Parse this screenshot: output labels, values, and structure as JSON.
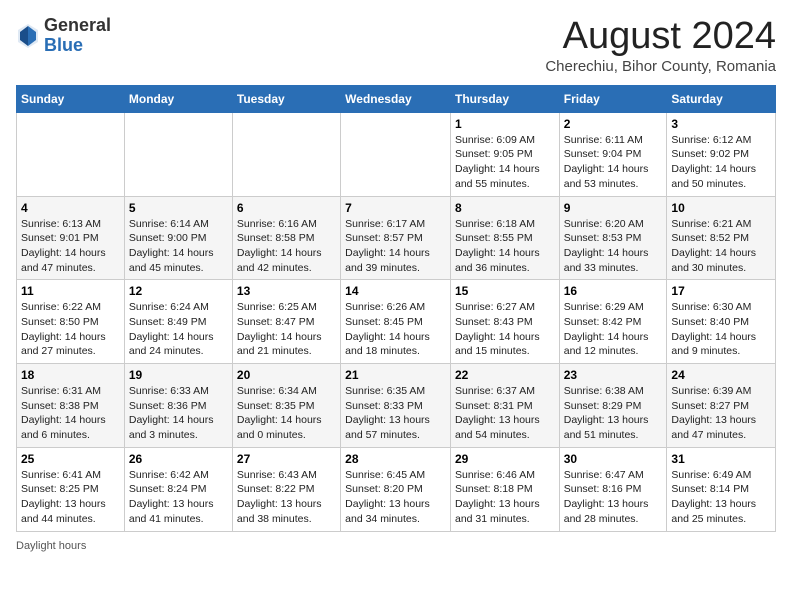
{
  "header": {
    "logo_general": "General",
    "logo_blue": "Blue",
    "month_title": "August 2024",
    "location": "Cherechiu, Bihor County, Romania"
  },
  "days_of_week": [
    "Sunday",
    "Monday",
    "Tuesday",
    "Wednesday",
    "Thursday",
    "Friday",
    "Saturday"
  ],
  "weeks": [
    [
      {
        "day": "",
        "info": ""
      },
      {
        "day": "",
        "info": ""
      },
      {
        "day": "",
        "info": ""
      },
      {
        "day": "",
        "info": ""
      },
      {
        "day": "1",
        "info": "Sunrise: 6:09 AM\nSunset: 9:05 PM\nDaylight: 14 hours and 55 minutes."
      },
      {
        "day": "2",
        "info": "Sunrise: 6:11 AM\nSunset: 9:04 PM\nDaylight: 14 hours and 53 minutes."
      },
      {
        "day": "3",
        "info": "Sunrise: 6:12 AM\nSunset: 9:02 PM\nDaylight: 14 hours and 50 minutes."
      }
    ],
    [
      {
        "day": "4",
        "info": "Sunrise: 6:13 AM\nSunset: 9:01 PM\nDaylight: 14 hours and 47 minutes."
      },
      {
        "day": "5",
        "info": "Sunrise: 6:14 AM\nSunset: 9:00 PM\nDaylight: 14 hours and 45 minutes."
      },
      {
        "day": "6",
        "info": "Sunrise: 6:16 AM\nSunset: 8:58 PM\nDaylight: 14 hours and 42 minutes."
      },
      {
        "day": "7",
        "info": "Sunrise: 6:17 AM\nSunset: 8:57 PM\nDaylight: 14 hours and 39 minutes."
      },
      {
        "day": "8",
        "info": "Sunrise: 6:18 AM\nSunset: 8:55 PM\nDaylight: 14 hours and 36 minutes."
      },
      {
        "day": "9",
        "info": "Sunrise: 6:20 AM\nSunset: 8:53 PM\nDaylight: 14 hours and 33 minutes."
      },
      {
        "day": "10",
        "info": "Sunrise: 6:21 AM\nSunset: 8:52 PM\nDaylight: 14 hours and 30 minutes."
      }
    ],
    [
      {
        "day": "11",
        "info": "Sunrise: 6:22 AM\nSunset: 8:50 PM\nDaylight: 14 hours and 27 minutes."
      },
      {
        "day": "12",
        "info": "Sunrise: 6:24 AM\nSunset: 8:49 PM\nDaylight: 14 hours and 24 minutes."
      },
      {
        "day": "13",
        "info": "Sunrise: 6:25 AM\nSunset: 8:47 PM\nDaylight: 14 hours and 21 minutes."
      },
      {
        "day": "14",
        "info": "Sunrise: 6:26 AM\nSunset: 8:45 PM\nDaylight: 14 hours and 18 minutes."
      },
      {
        "day": "15",
        "info": "Sunrise: 6:27 AM\nSunset: 8:43 PM\nDaylight: 14 hours and 15 minutes."
      },
      {
        "day": "16",
        "info": "Sunrise: 6:29 AM\nSunset: 8:42 PM\nDaylight: 14 hours and 12 minutes."
      },
      {
        "day": "17",
        "info": "Sunrise: 6:30 AM\nSunset: 8:40 PM\nDaylight: 14 hours and 9 minutes."
      }
    ],
    [
      {
        "day": "18",
        "info": "Sunrise: 6:31 AM\nSunset: 8:38 PM\nDaylight: 14 hours and 6 minutes."
      },
      {
        "day": "19",
        "info": "Sunrise: 6:33 AM\nSunset: 8:36 PM\nDaylight: 14 hours and 3 minutes."
      },
      {
        "day": "20",
        "info": "Sunrise: 6:34 AM\nSunset: 8:35 PM\nDaylight: 14 hours and 0 minutes."
      },
      {
        "day": "21",
        "info": "Sunrise: 6:35 AM\nSunset: 8:33 PM\nDaylight: 13 hours and 57 minutes."
      },
      {
        "day": "22",
        "info": "Sunrise: 6:37 AM\nSunset: 8:31 PM\nDaylight: 13 hours and 54 minutes."
      },
      {
        "day": "23",
        "info": "Sunrise: 6:38 AM\nSunset: 8:29 PM\nDaylight: 13 hours and 51 minutes."
      },
      {
        "day": "24",
        "info": "Sunrise: 6:39 AM\nSunset: 8:27 PM\nDaylight: 13 hours and 47 minutes."
      }
    ],
    [
      {
        "day": "25",
        "info": "Sunrise: 6:41 AM\nSunset: 8:25 PM\nDaylight: 13 hours and 44 minutes."
      },
      {
        "day": "26",
        "info": "Sunrise: 6:42 AM\nSunset: 8:24 PM\nDaylight: 13 hours and 41 minutes."
      },
      {
        "day": "27",
        "info": "Sunrise: 6:43 AM\nSunset: 8:22 PM\nDaylight: 13 hours and 38 minutes."
      },
      {
        "day": "28",
        "info": "Sunrise: 6:45 AM\nSunset: 8:20 PM\nDaylight: 13 hours and 34 minutes."
      },
      {
        "day": "29",
        "info": "Sunrise: 6:46 AM\nSunset: 8:18 PM\nDaylight: 13 hours and 31 minutes."
      },
      {
        "day": "30",
        "info": "Sunrise: 6:47 AM\nSunset: 8:16 PM\nDaylight: 13 hours and 28 minutes."
      },
      {
        "day": "31",
        "info": "Sunrise: 6:49 AM\nSunset: 8:14 PM\nDaylight: 13 hours and 25 minutes."
      }
    ]
  ],
  "footer": {
    "daylight_hours_label": "Daylight hours"
  }
}
